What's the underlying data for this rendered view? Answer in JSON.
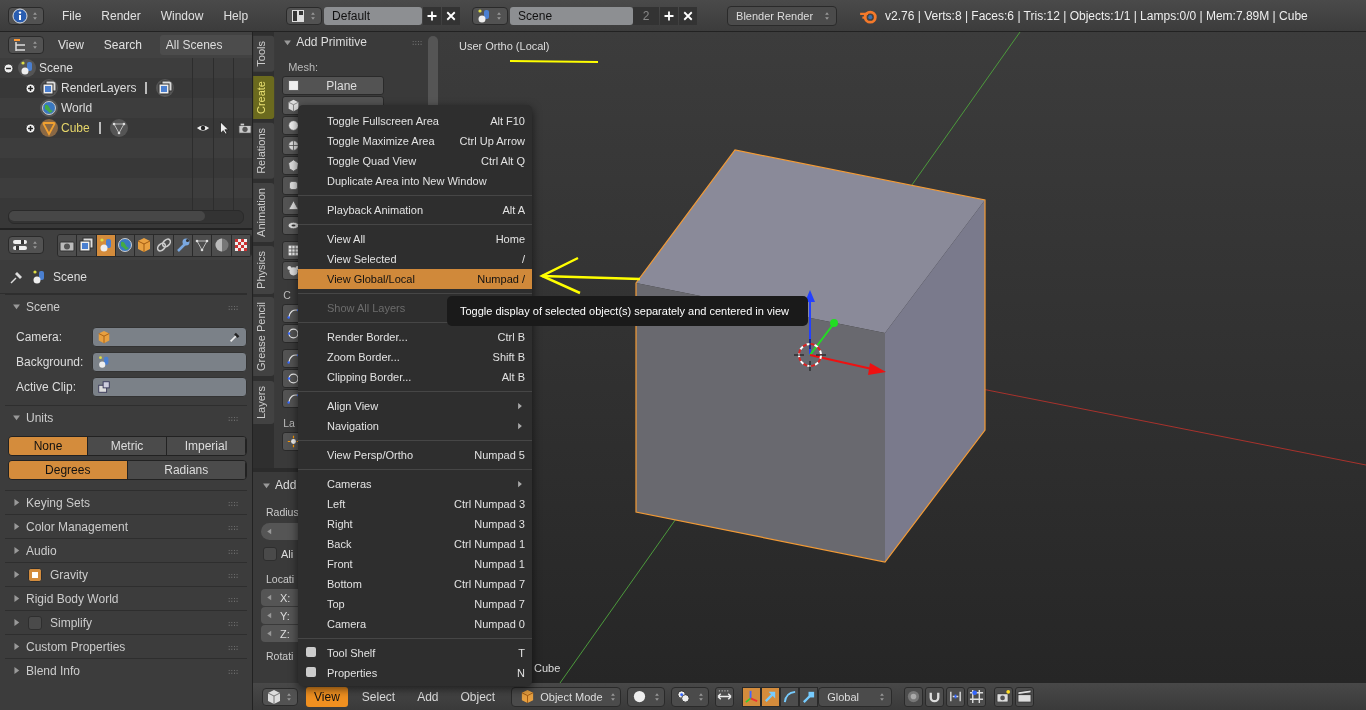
{
  "top_bar": {
    "menus": [
      "File",
      "Render",
      "Window",
      "Help"
    ],
    "screen_layout": "Default",
    "scene": "Scene",
    "scene_users": "2",
    "render_engine": "Blender Render",
    "stats": "v2.76 | Verts:8 | Faces:6 | Tris:12 | Objects:1/1 | Lamps:0/0 | Mem:7.89M | Cube"
  },
  "outliner": {
    "menus": [
      "View",
      "Search"
    ],
    "filter": "All Scenes",
    "tree": [
      {
        "label": "Scene",
        "kind": "scene",
        "expanded": true,
        "selected": false,
        "children": [
          {
            "label": "RenderLayers",
            "kind": "renderlayers",
            "expanded": false,
            "selected": false
          },
          {
            "label": "World",
            "kind": "world",
            "selected": false
          },
          {
            "label": "Cube",
            "kind": "object",
            "expanded": false,
            "selected": true
          }
        ]
      }
    ]
  },
  "properties": {
    "tabs": [
      {
        "kind": "render",
        "selected": false
      },
      {
        "kind": "render_layers",
        "selected": false
      },
      {
        "kind": "scene",
        "selected": true
      },
      {
        "kind": "world",
        "selected": false
      },
      {
        "kind": "object",
        "selected": false
      },
      {
        "kind": "constraints",
        "selected": false
      },
      {
        "kind": "modifiers",
        "selected": false
      },
      {
        "kind": "data",
        "selected": false
      },
      {
        "kind": "material",
        "selected": false
      },
      {
        "kind": "texture",
        "selected": false
      }
    ],
    "context": "Scene",
    "panels": [
      {
        "title": "Scene",
        "kind": "fields",
        "expanded": true,
        "fields": [
          {
            "label": "Camera:",
            "kind": "object",
            "eyedropper": true
          },
          {
            "label": "Background:",
            "kind": "scene",
            "eyedropper": false
          },
          {
            "label": "Active Clip:",
            "kind": "clip",
            "eyedropper": false
          }
        ]
      },
      {
        "title": "Units",
        "kind": "units",
        "expanded": true,
        "systems": [
          {
            "label": "None",
            "selected": true
          },
          {
            "label": "Metric",
            "selected": false
          },
          {
            "label": "Imperial",
            "selected": false
          }
        ],
        "rotation": [
          {
            "label": "Degrees",
            "selected": true
          },
          {
            "label": "Radians",
            "selected": false
          }
        ]
      },
      {
        "title": "Keying Sets",
        "kind": "plain",
        "expanded": false
      },
      {
        "title": "Color Management",
        "kind": "plain",
        "expanded": false
      },
      {
        "title": "Audio",
        "kind": "plain",
        "expanded": false
      },
      {
        "title": "Gravity",
        "kind": "checkbox",
        "expanded": false,
        "checked": true
      },
      {
        "title": "Rigid Body World",
        "kind": "plain",
        "expanded": false
      },
      {
        "title": "Simplify",
        "kind": "checkbox",
        "expanded": false,
        "checked": false
      },
      {
        "title": "Custom Properties",
        "kind": "plain",
        "expanded": false
      },
      {
        "title": "Blend Info",
        "kind": "plain",
        "expanded": false
      }
    ]
  },
  "tool_shelf": {
    "tabs": [
      {
        "label": "Tools",
        "selected": false
      },
      {
        "label": "Create",
        "selected": true
      },
      {
        "label": "Relations",
        "selected": false
      },
      {
        "label": "Animation",
        "selected": false
      },
      {
        "label": "Physics",
        "selected": false
      },
      {
        "label": "Grease Pencil",
        "selected": false
      },
      {
        "label": "Layers",
        "selected": false
      }
    ],
    "panel_title": "Add Primitive",
    "section": "Mesh:",
    "plane_button": "Plane",
    "curve_label": "C",
    "lamp_label": "La",
    "operator_panel": {
      "title": "Add",
      "radius_label": "Radius",
      "align": {
        "label": "Ali",
        "checked": false
      },
      "location_label": "Locati",
      "axes": [
        "X:",
        "Y:",
        "Z:"
      ],
      "rotation_label": "Rotati"
    }
  },
  "viewport": {
    "title": "User Ortho (Local)",
    "object_label": "Cube"
  },
  "view_menu": {
    "items": [
      {
        "kind": "item",
        "label": "Toggle Fullscreen Area",
        "shortcut": "Alt F10",
        "selected": false,
        "disabled": false
      },
      {
        "kind": "item",
        "label": "Toggle Maximize Area",
        "shortcut": "Ctrl Up Arrow",
        "selected": false,
        "disabled": false
      },
      {
        "kind": "item",
        "label": "Toggle Quad View",
        "shortcut": "Ctrl Alt Q",
        "selected": false,
        "disabled": false
      },
      {
        "kind": "item",
        "label": "Duplicate Area into New Window",
        "selected": false,
        "disabled": false
      },
      {
        "kind": "separator"
      },
      {
        "kind": "item",
        "label": "Playback Animation",
        "shortcut": "Alt A",
        "selected": false,
        "disabled": false
      },
      {
        "kind": "separator"
      },
      {
        "kind": "item",
        "label": "View All",
        "shortcut": "Home",
        "selected": false,
        "disabled": false
      },
      {
        "kind": "item",
        "label": "View Selected",
        "shortcut": "/",
        "selected": false,
        "disabled": false
      },
      {
        "kind": "item",
        "label": "View Global/Local",
        "shortcut": "Numpad /",
        "selected": true,
        "disabled": false
      },
      {
        "kind": "separator"
      },
      {
        "kind": "item",
        "label": "Show All Layers",
        "selected": false,
        "disabled": true
      },
      {
        "kind": "separator"
      },
      {
        "kind": "item",
        "label": "Render Border...",
        "shortcut": "Ctrl B",
        "selected": false,
        "disabled": false
      },
      {
        "kind": "item",
        "label": "Zoom Border...",
        "shortcut": "Shift B",
        "selected": false,
        "disabled": false
      },
      {
        "kind": "item",
        "label": "Clipping Border...",
        "shortcut": "Alt B",
        "selected": false,
        "disabled": false
      },
      {
        "kind": "separator"
      },
      {
        "kind": "submenu",
        "label": "Align View",
        "selected": false,
        "disabled": false
      },
      {
        "kind": "submenu",
        "label": "Navigation",
        "selected": false,
        "disabled": false
      },
      {
        "kind": "separator"
      },
      {
        "kind": "item",
        "label": "View Persp/Ortho",
        "shortcut": "Numpad 5",
        "selected": false,
        "disabled": false
      },
      {
        "kind": "separator"
      },
      {
        "kind": "submenu",
        "label": "Cameras",
        "selected": false,
        "disabled": false
      },
      {
        "kind": "item",
        "label": "Left",
        "shortcut": "Ctrl Numpad 3",
        "selected": false,
        "disabled": false
      },
      {
        "kind": "item",
        "label": "Right",
        "shortcut": "Numpad 3",
        "selected": false,
        "disabled": false
      },
      {
        "kind": "item",
        "label": "Back",
        "shortcut": "Ctrl Numpad 1",
        "selected": false,
        "disabled": false
      },
      {
        "kind": "item",
        "label": "Front",
        "shortcut": "Numpad 1",
        "selected": false,
        "disabled": false
      },
      {
        "kind": "item",
        "label": "Bottom",
        "shortcut": "Ctrl Numpad 7",
        "selected": false,
        "disabled": false
      },
      {
        "kind": "item",
        "label": "Top",
        "shortcut": "Numpad 7",
        "selected": false,
        "disabled": false
      },
      {
        "kind": "item",
        "label": "Camera",
        "shortcut": "Numpad 0",
        "selected": false,
        "disabled": false
      },
      {
        "kind": "separator"
      },
      {
        "kind": "checkbox",
        "label": "Tool Shelf",
        "shortcut": "T",
        "checked": false,
        "selected": false,
        "disabled": false
      },
      {
        "kind": "checkbox",
        "label": "Properties",
        "shortcut": "N",
        "checked": false,
        "selected": false,
        "disabled": false
      }
    ]
  },
  "tooltip": "Toggle display of selected object(s) separately and centered in view",
  "bottom_bar": {
    "menus": [
      {
        "label": "View",
        "selected": true
      },
      {
        "label": "Select",
        "selected": false
      },
      {
        "label": "Add",
        "selected": false
      },
      {
        "label": "Object",
        "selected": false
      }
    ],
    "mode": "Object Mode",
    "orientation": "Global",
    "manipulators": [
      {
        "kind": "axes",
        "selected": true
      },
      {
        "kind": "translate",
        "selected": true
      },
      {
        "kind": "rotate",
        "selected": false
      },
      {
        "kind": "scale",
        "selected": false
      }
    ]
  }
}
